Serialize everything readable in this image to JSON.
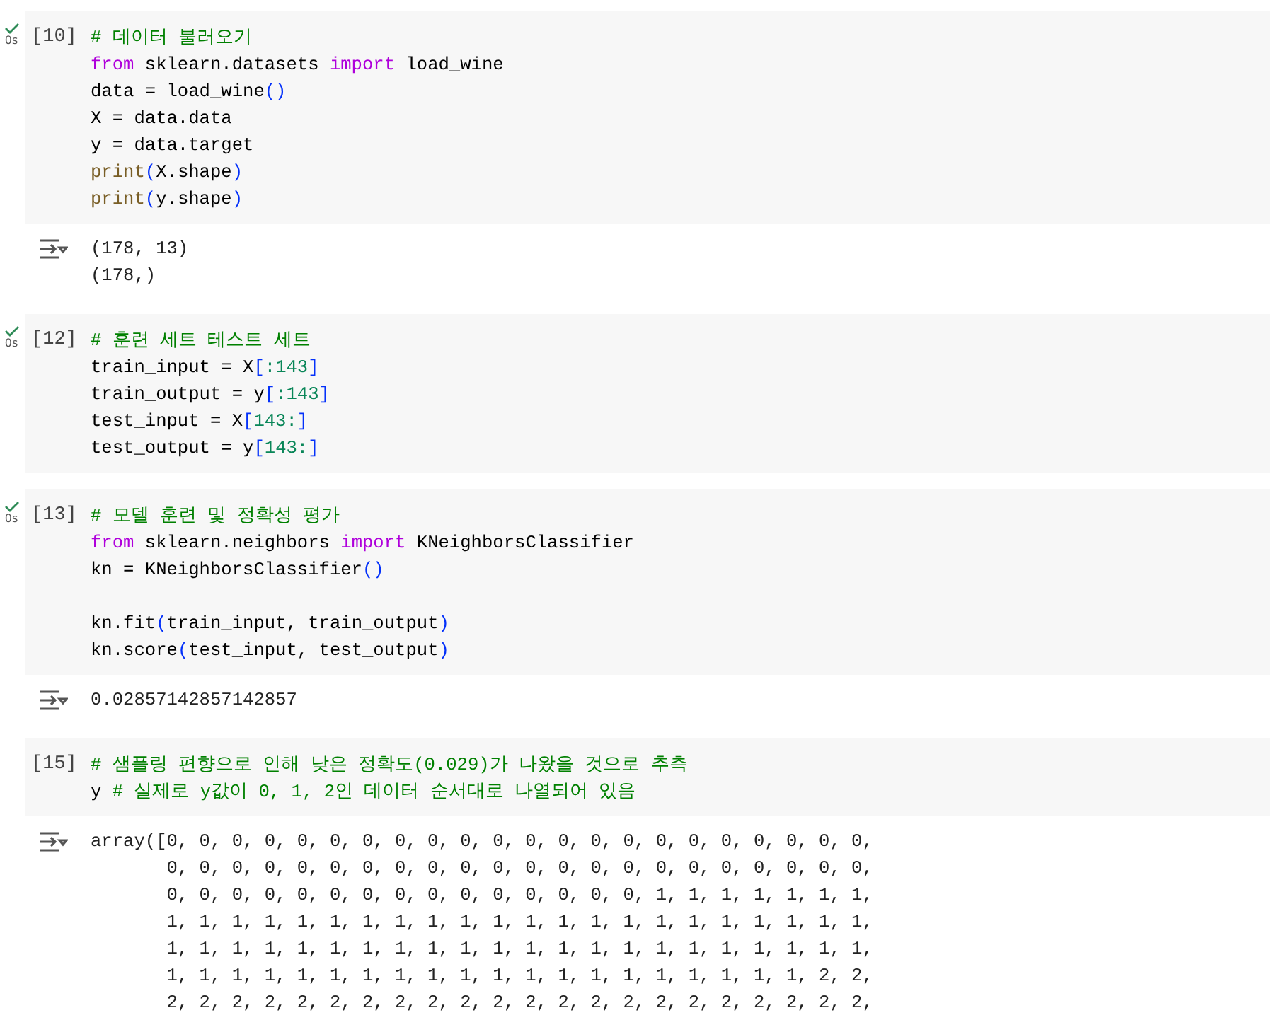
{
  "cells": [
    {
      "exec_count": "[10]",
      "done": true,
      "time": "0s",
      "code": [
        [
          {
            "kind": "comment",
            "text": "# 데이터 불러오기"
          }
        ],
        [
          {
            "kind": "keyword",
            "text": "from"
          },
          {
            "kind": "plain",
            "text": " sklearn.datasets "
          },
          {
            "kind": "keyword",
            "text": "import"
          },
          {
            "kind": "plain",
            "text": " load_wine"
          }
        ],
        [
          {
            "kind": "plain",
            "text": "data = load_wine"
          },
          {
            "kind": "bracket",
            "text": "()"
          }
        ],
        [
          {
            "kind": "plain",
            "text": "X = data.data"
          }
        ],
        [
          {
            "kind": "plain",
            "text": "y = data.target"
          }
        ],
        [
          {
            "kind": "func",
            "text": "print"
          },
          {
            "kind": "bracket",
            "text": "("
          },
          {
            "kind": "plain",
            "text": "X.shape"
          },
          {
            "kind": "bracket",
            "text": ")"
          }
        ],
        [
          {
            "kind": "func",
            "text": "print"
          },
          {
            "kind": "bracket",
            "text": "("
          },
          {
            "kind": "plain",
            "text": "y.shape"
          },
          {
            "kind": "bracket",
            "text": ")"
          }
        ]
      ],
      "output": [
        "(178, 13)",
        "(178,)"
      ]
    },
    {
      "exec_count": "[12]",
      "done": true,
      "time": "0s",
      "code": [
        [
          {
            "kind": "comment",
            "text": "# 훈련 세트 테스트 세트"
          }
        ],
        [
          {
            "kind": "plain",
            "text": "train_input = X"
          },
          {
            "kind": "bracket",
            "text": "["
          },
          {
            "kind": "number",
            "text": ":143"
          },
          {
            "kind": "bracket",
            "text": "]"
          }
        ],
        [
          {
            "kind": "plain",
            "text": "train_output = y"
          },
          {
            "kind": "bracket",
            "text": "["
          },
          {
            "kind": "number",
            "text": ":143"
          },
          {
            "kind": "bracket",
            "text": "]"
          }
        ],
        [
          {
            "kind": "plain",
            "text": "test_input = X"
          },
          {
            "kind": "bracket",
            "text": "["
          },
          {
            "kind": "number",
            "text": "143:"
          },
          {
            "kind": "bracket",
            "text": "]"
          }
        ],
        [
          {
            "kind": "plain",
            "text": "test_output = y"
          },
          {
            "kind": "bracket",
            "text": "["
          },
          {
            "kind": "number",
            "text": "143:"
          },
          {
            "kind": "bracket",
            "text": "]"
          }
        ]
      ]
    },
    {
      "exec_count": "[13]",
      "done": true,
      "time": "0s",
      "code": [
        [
          {
            "kind": "comment",
            "text": "# 모델 훈련 및 정확성 평가"
          }
        ],
        [
          {
            "kind": "keyword",
            "text": "from"
          },
          {
            "kind": "plain",
            "text": " sklearn.neighbors "
          },
          {
            "kind": "keyword",
            "text": "import"
          },
          {
            "kind": "plain",
            "text": " KNeighborsClassifier"
          }
        ],
        [
          {
            "kind": "plain",
            "text": "kn = KNeighborsClassifier"
          },
          {
            "kind": "bracket",
            "text": "()"
          }
        ],
        [
          {
            "kind": "break"
          },
          {
            "kind": "plain",
            "text": "kn.fit"
          },
          {
            "kind": "bracket",
            "text": "("
          },
          {
            "kind": "plain",
            "text": "train_input, train_output"
          },
          {
            "kind": "bracket",
            "text": ")"
          }
        ],
        [
          {
            "kind": "plain",
            "text": "kn.score"
          },
          {
            "kind": "bracket",
            "text": "("
          },
          {
            "kind": "plain",
            "text": "test_input, test_output"
          },
          {
            "kind": "bracket",
            "text": ")"
          }
        ]
      ],
      "output": [
        "0.02857142857142857"
      ]
    },
    {
      "exec_count": "[15]",
      "done": false,
      "code": [
        [
          {
            "kind": "comment",
            "text": "# 샘플링 편향으로 인해 낮은 정확도(0.029)가 나왔을 것으로 추측"
          }
        ],
        [
          {
            "kind": "plain",
            "text": "y "
          },
          {
            "kind": "comment",
            "text": "# 실제로 y값이 0, 1, 2인 데이터 순서대로 나열되어 있음"
          }
        ]
      ],
      "output": [
        "array([0, 0, 0, 0, 0, 0, 0, 0, 0, 0, 0, 0, 0, 0, 0, 0, 0, 0, 0, 0, 0, 0,",
        "       0, 0, 0, 0, 0, 0, 0, 0, 0, 0, 0, 0, 0, 0, 0, 0, 0, 0, 0, 0, 0, 0,",
        "       0, 0, 0, 0, 0, 0, 0, 0, 0, 0, 0, 0, 0, 0, 0, 1, 1, 1, 1, 1, 1, 1,",
        "       1, 1, 1, 1, 1, 1, 1, 1, 1, 1, 1, 1, 1, 1, 1, 1, 1, 1, 1, 1, 1, 1,",
        "       1, 1, 1, 1, 1, 1, 1, 1, 1, 1, 1, 1, 1, 1, 1, 1, 1, 1, 1, 1, 1, 1,",
        "       1, 1, 1, 1, 1, 1, 1, 1, 1, 1, 1, 1, 1, 1, 1, 1, 1, 1, 1, 1, 2, 2,",
        "       2, 2, 2, 2, 2, 2, 2, 2, 2, 2, 2, 2, 2, 2, 2, 2, 2, 2, 2, 2, 2, 2,"
      ]
    }
  ]
}
